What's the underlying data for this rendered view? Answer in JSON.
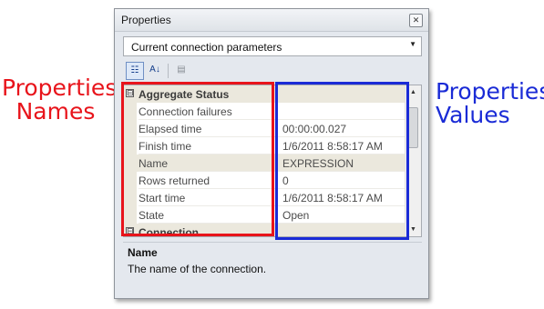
{
  "annotations": {
    "names_label": [
      "Properties",
      "Names"
    ],
    "values_label": [
      "Properties",
      "Values"
    ],
    "names_color": "#e8141b",
    "values_color": "#1a2bd6"
  },
  "window": {
    "title": "Properties",
    "close_icon": "close-icon"
  },
  "dropdown": {
    "selected": "Current connection parameters"
  },
  "toolbar": {
    "categorized_icon": "categorized-icon",
    "alphabetical_icon": "alphabetical-icon",
    "property_pages_icon": "property-pages-icon"
  },
  "grid": {
    "rows": [
      {
        "type": "category",
        "name": "Aggregate Status",
        "value": "",
        "expander": "⊟"
      },
      {
        "type": "property",
        "name": "Connection failures",
        "value": ""
      },
      {
        "type": "property",
        "name": "Elapsed time",
        "value": "00:00:00.027"
      },
      {
        "type": "property",
        "name": "Finish time",
        "value": "1/6/2011 8:58:17 AM"
      },
      {
        "type": "property",
        "name": "Name",
        "value": "EXPRESSION",
        "selected": true
      },
      {
        "type": "property",
        "name": "Rows returned",
        "value": "0"
      },
      {
        "type": "property",
        "name": "Start time",
        "value": "1/6/2011 8:58:17 AM"
      },
      {
        "type": "property",
        "name": "State",
        "value": "Open"
      },
      {
        "type": "category",
        "name": "Connection",
        "value": "",
        "expander": "⊟"
      }
    ]
  },
  "description": {
    "title": "Name",
    "text": "The name of the connection."
  }
}
